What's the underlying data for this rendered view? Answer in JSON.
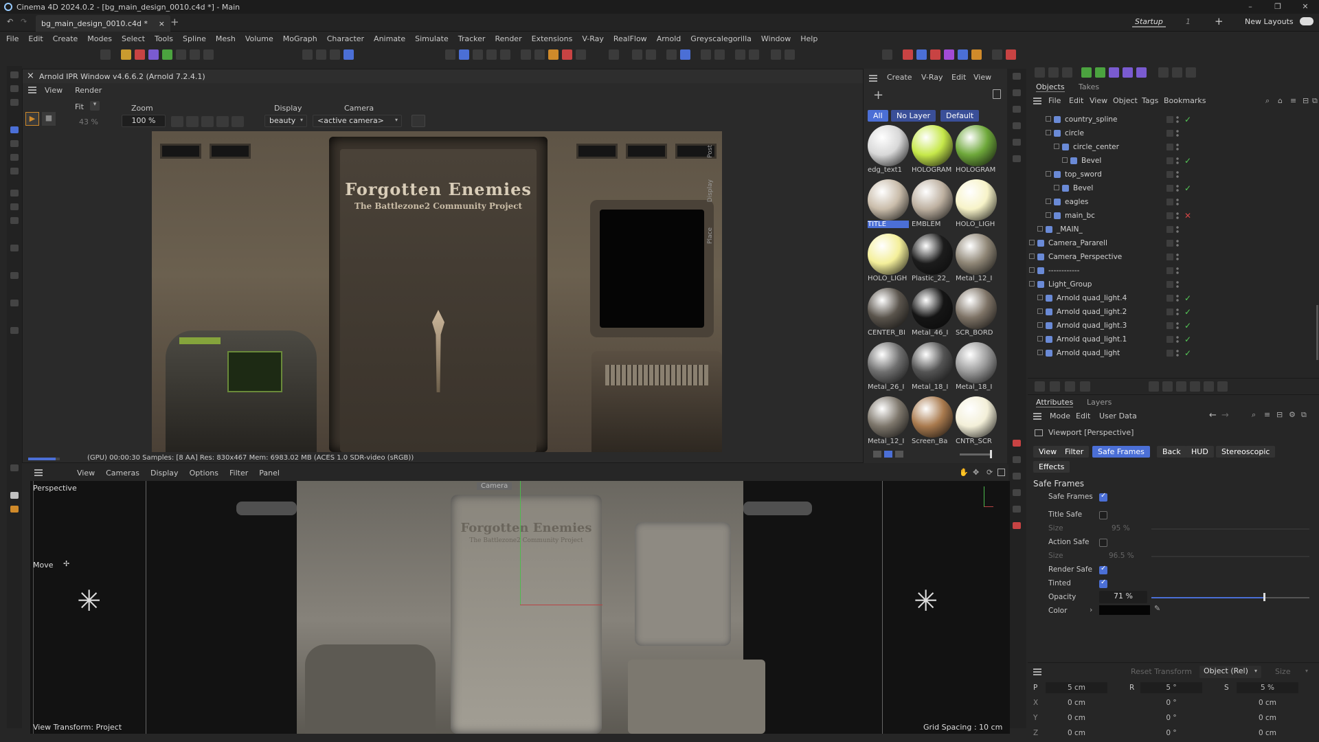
{
  "window": {
    "title": "Cinema 4D 2024.0.2 - [bg_main_design_0010.c4d *] - Main",
    "minimize": "–",
    "maximize": "❐",
    "close": "✕"
  },
  "tabs": {
    "doc": "bg_main_design_0010.c4d *",
    "close": "×",
    "add": "+",
    "layout": "Startup",
    "layout_num": "1",
    "new_layouts": "New Layouts"
  },
  "menu": [
    "File",
    "Edit",
    "Create",
    "Modes",
    "Select",
    "Tools",
    "Spline",
    "Mesh",
    "Volume",
    "MoGraph",
    "Character",
    "Animate",
    "Simulate",
    "Tracker",
    "Render",
    "Extensions",
    "V-Ray",
    "RealFlow",
    "Arnold",
    "Greyscalegorilla",
    "Window",
    "Help"
  ],
  "ipr": {
    "title": "Arnold IPR Window v4.6.6.2 (Arnold 7.2.4.1)",
    "menu": [
      "View",
      "Render"
    ],
    "fit_label": "Fit",
    "fit_value": "43 %",
    "zoom_label": "Zoom",
    "zoom_value": "100 %",
    "display_label": "Display",
    "display_value": "beauty",
    "camera_label": "Camera",
    "camera_value": "<active camera>",
    "status": "(GPU) 00:00:30  Samples: [8 AA]  Res: 830x467  Mem: 6983.02 MB  (ACES 1.0 SDR-video (sRGB))",
    "render_title": "Forgotten Enemies",
    "render_subtitle": "The Battlezone2 Community Project",
    "side_tabs": [
      "Post",
      "Display",
      "Place"
    ]
  },
  "materials": {
    "menu": [
      "Create",
      "V-Ray",
      "Edit",
      "View"
    ],
    "filters": [
      "All",
      "No Layer",
      "Default"
    ],
    "items": [
      {
        "name": "edg_text1",
        "color": "#d8d8d8"
      },
      {
        "name": "HOLOGRAM",
        "color": "#c6e84a"
      },
      {
        "name": "HOLOGRAM",
        "color": "#6ea83a"
      },
      {
        "name": "TITLE",
        "color": "#c9bcaa"
      },
      {
        "name": "EMBLEM",
        "color": "#bdb0a0"
      },
      {
        "name": "HOLO_LIGH",
        "color": "#f7f3c8"
      },
      {
        "name": "HOLO_LIGH",
        "color": "#f4ef9a"
      },
      {
        "name": "Plastic_22_",
        "color": "#1c1c1c"
      },
      {
        "name": "Metal_12_I",
        "color": "#8f8676"
      },
      {
        "name": "CENTER_BI",
        "color": "#5a544c"
      },
      {
        "name": "Metal_46_I",
        "color": "#151515"
      },
      {
        "name": "SCR_BORD",
        "color": "#7e7366"
      },
      {
        "name": "Metal_26_I",
        "color": "#6f6f6f"
      },
      {
        "name": "Metal_18_I",
        "color": "#545454"
      },
      {
        "name": "Metal_18_I",
        "color": "#9a9a9a"
      },
      {
        "name": "Metal_12_I",
        "color": "#7d766b"
      },
      {
        "name": "Screen_Ba",
        "color": "#a97a4e"
      },
      {
        "name": "CNTR_SCR",
        "color": "#f3efd8"
      }
    ]
  },
  "viewport": {
    "menu": [
      "View",
      "Cameras",
      "Display",
      "Options",
      "Filter",
      "Panel"
    ],
    "name": "Perspective",
    "move": "Move",
    "transform": "View Transform: Project",
    "grid": "Grid Spacing : 10 cm",
    "camera_label": "Camera",
    "title": "Forgotten Enemies",
    "subtitle": "The Battlezone2 Community Project"
  },
  "objects": {
    "tabs": [
      "Objects",
      "Takes"
    ],
    "menu": [
      "File",
      "Edit",
      "View",
      "Object",
      "Tags",
      "Bookmarks"
    ],
    "rows": [
      {
        "name": "country_spline",
        "indent": 2,
        "check": "✓"
      },
      {
        "name": "circle",
        "indent": 2,
        "check": ""
      },
      {
        "name": "circle_center",
        "indent": 3,
        "check": ""
      },
      {
        "name": "Bevel",
        "indent": 4,
        "check": "✓"
      },
      {
        "name": "top_sword",
        "indent": 2,
        "check": ""
      },
      {
        "name": "Bevel",
        "indent": 3,
        "check": "✓"
      },
      {
        "name": "eagles",
        "indent": 2,
        "check": ""
      },
      {
        "name": "main_bc",
        "indent": 2,
        "check": "✕"
      },
      {
        "name": "_MAIN_",
        "indent": 1,
        "check": ""
      },
      {
        "name": "Camera_Pararell",
        "indent": 0,
        "check": ""
      },
      {
        "name": "Camera_Perspective",
        "indent": 0,
        "check": ""
      },
      {
        "name": "------------",
        "indent": 0,
        "check": ""
      },
      {
        "name": "Light_Group",
        "indent": 0,
        "check": ""
      },
      {
        "name": "Arnold quad_light.4",
        "indent": 1,
        "check": "✓"
      },
      {
        "name": "Arnold quad_light.2",
        "indent": 1,
        "check": "✓"
      },
      {
        "name": "Arnold quad_light.3",
        "indent": 1,
        "check": "✓"
      },
      {
        "name": "Arnold quad_light.1",
        "indent": 1,
        "check": "✓"
      },
      {
        "name": "Arnold quad_light",
        "indent": 1,
        "check": "✓"
      }
    ]
  },
  "attributes": {
    "tabs": [
      "Attributes",
      "Layers"
    ],
    "menu": [
      "Mode",
      "Edit",
      "User Data"
    ],
    "object": "Viewport [Perspective]",
    "subtabs": [
      "View",
      "Filter",
      "Safe Frames",
      "Back",
      "HUD",
      "Stereoscopic"
    ],
    "effects": "Effects",
    "section": "Safe Frames",
    "safe_frames": "Safe Frames",
    "title_safe": "Title Safe",
    "size": "Size",
    "title_size": "95 %",
    "action_safe": "Action Safe",
    "action_size": "96.5 %",
    "render_safe": "Render Safe",
    "tinted": "Tinted",
    "opacity": "Opacity",
    "opacity_value": "71 %",
    "opacity_fraction": 0.71,
    "color": "Color"
  },
  "coords": {
    "reset": "Reset Transform",
    "mode": "Object (Rel)",
    "size": "Size",
    "labels": [
      "P",
      "R",
      "S"
    ],
    "axes": [
      "X",
      "Y",
      "Z"
    ],
    "p_top": "5 cm",
    "r_top": "5 °",
    "s_top": "5 %",
    "x": [
      "0 cm",
      "0 °",
      "0 cm"
    ],
    "y": [
      "0 cm",
      "0 °",
      "0 cm"
    ],
    "z": [
      "0 cm",
      "0 °",
      "0 cm"
    ]
  }
}
